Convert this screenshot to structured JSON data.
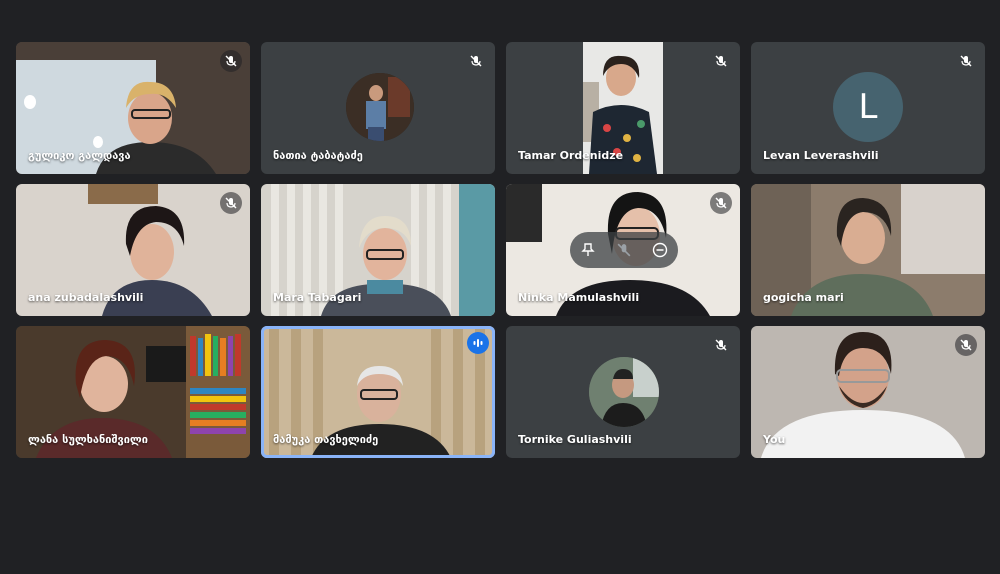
{
  "participants": [
    {
      "name": "გულიკო გალდავა",
      "muted": true
    },
    {
      "name": "ნათია ტაბატაძე",
      "muted": true
    },
    {
      "name": "Tamar Ordenidze",
      "muted": true
    },
    {
      "name": "Levan Leverashvili",
      "muted": true,
      "avatar_letter": "L"
    },
    {
      "name": "ana zubadalashvili",
      "muted": true
    },
    {
      "name": "Mara Tabagari",
      "muted": false
    },
    {
      "name": "Ninka Mamulashvili",
      "muted": true
    },
    {
      "name": "gogicha mari",
      "muted": false
    },
    {
      "name": "ლანა სულხანიშვილი",
      "muted": false
    },
    {
      "name": "მამუკა თავხელიძე",
      "muted": false,
      "speaking": true
    },
    {
      "name": "Tornike Guliashvili",
      "muted": true
    },
    {
      "name": "You",
      "muted": true
    }
  ],
  "colors": {
    "background": "#202124",
    "tile": "#3c4043",
    "accent": "#8ab4f8",
    "speaking": "#1a73e8"
  }
}
